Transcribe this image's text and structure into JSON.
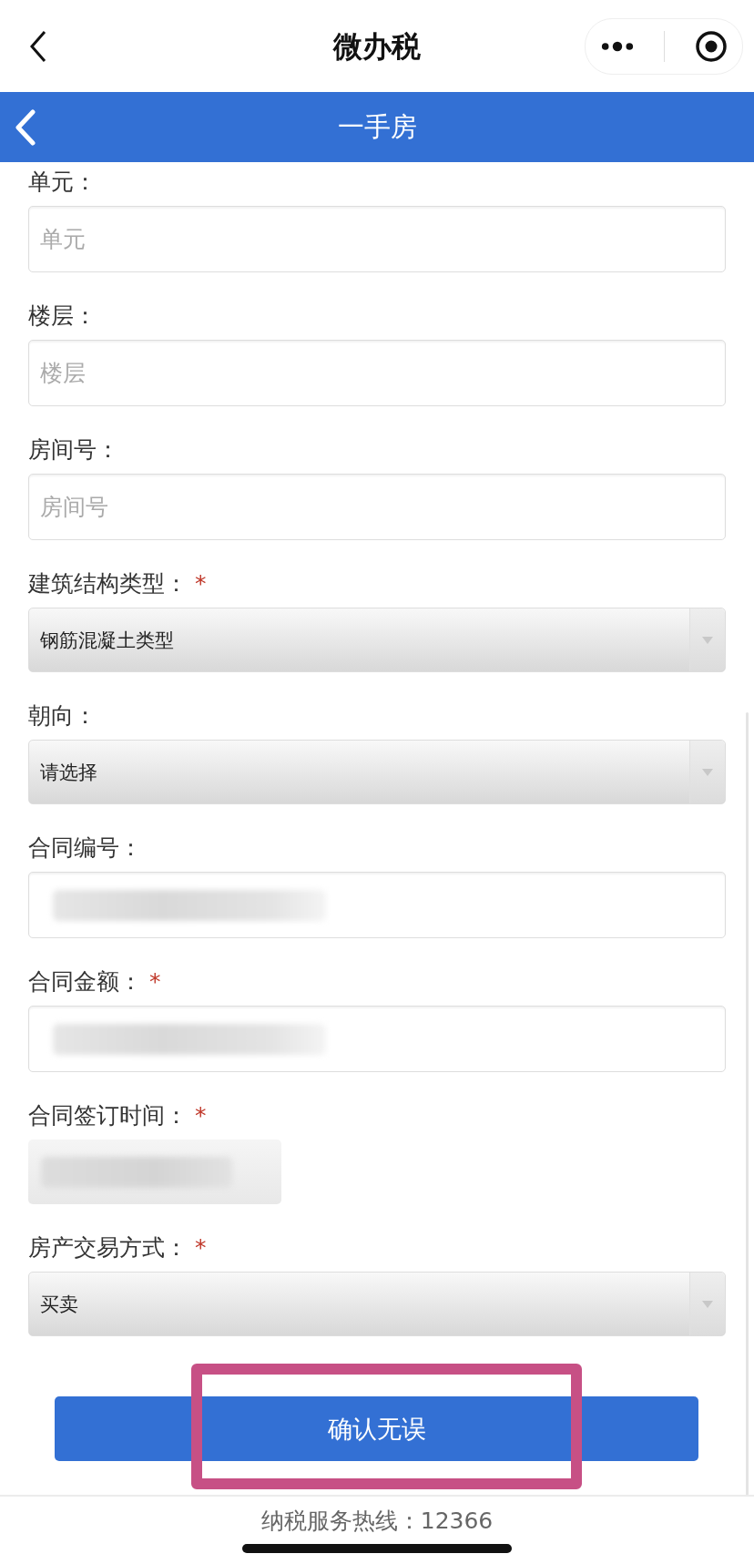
{
  "nav": {
    "title": "微办税"
  },
  "header": {
    "title": "一手房"
  },
  "fields": [
    {
      "label": "单元：",
      "kind": "text",
      "placeholder": "单元"
    },
    {
      "label": "楼层：",
      "kind": "text",
      "placeholder": "楼层"
    },
    {
      "label": "房间号：",
      "kind": "text",
      "placeholder": "房间号"
    },
    {
      "label": "建筑结构类型：",
      "mark": "*",
      "kind": "select",
      "value": "钢筋混凝土类型"
    },
    {
      "label": "朝向：",
      "kind": "select",
      "value": "请选择"
    },
    {
      "label": "合同编号：",
      "kind": "blurred-text"
    },
    {
      "label": "合同金额：",
      "mark": "*",
      "kind": "blurred-text"
    },
    {
      "label": "合同签订时间：",
      "mark": "*",
      "kind": "blurred-select"
    },
    {
      "label": "房产交易方式：",
      "mark": "*",
      "kind": "select",
      "value": "买卖"
    }
  ],
  "submit": {
    "label": "确认无误",
    "highlighted": true
  },
  "footer": {
    "text": "纳税服务热线：12366"
  }
}
